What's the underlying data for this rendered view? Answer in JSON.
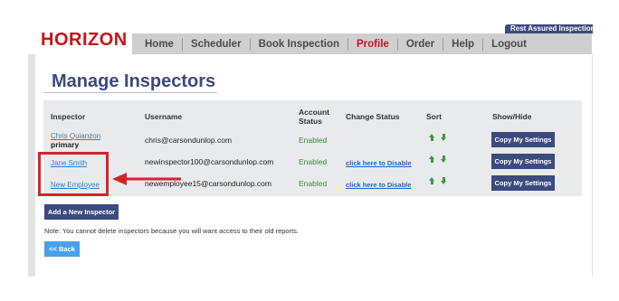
{
  "header": {
    "top_tab": "Rest Assured Inspection",
    "logo": "HORIZON",
    "nav": [
      "Home",
      "Scheduler",
      "Book Inspection",
      "Profile",
      "Order",
      "Help",
      "Logout"
    ]
  },
  "page": {
    "title": "Manage Inspectors"
  },
  "table": {
    "headers": {
      "inspector": "Inspector",
      "username": "Username",
      "account_status_1": "Account",
      "account_status_2": "Status",
      "change_status": "Change Status",
      "sort": "Sort",
      "show_hide": "Show/Hide"
    },
    "rows": [
      {
        "name": "Chris  Quianzon",
        "role": "primary",
        "username": "chris@carsondunlop.com",
        "status": "Enabled",
        "change": "",
        "button": "Copy My Settings"
      },
      {
        "name": "Jane  Smith",
        "role": "",
        "username": "newinspector100@carsondunlop.com",
        "status": "Enabled",
        "change": "click here to Disable",
        "button": "Copy My Settings"
      },
      {
        "name": "New  Employee",
        "role": "",
        "username": "newemployee15@carsondunlop.com",
        "status": "Enabled",
        "change": "click here to Disable",
        "button": "Copy My Settings"
      }
    ]
  },
  "actions": {
    "add": "Add a New Inspector",
    "note": "Note: You cannot delete inspectors because you will want access to their old reports.",
    "back": "<< Back"
  },
  "colors": {
    "brand_red": "#c4151c",
    "navy": "#3b4a7f",
    "enabled_green": "#3d8a3d",
    "highlight": "#d8222a"
  }
}
